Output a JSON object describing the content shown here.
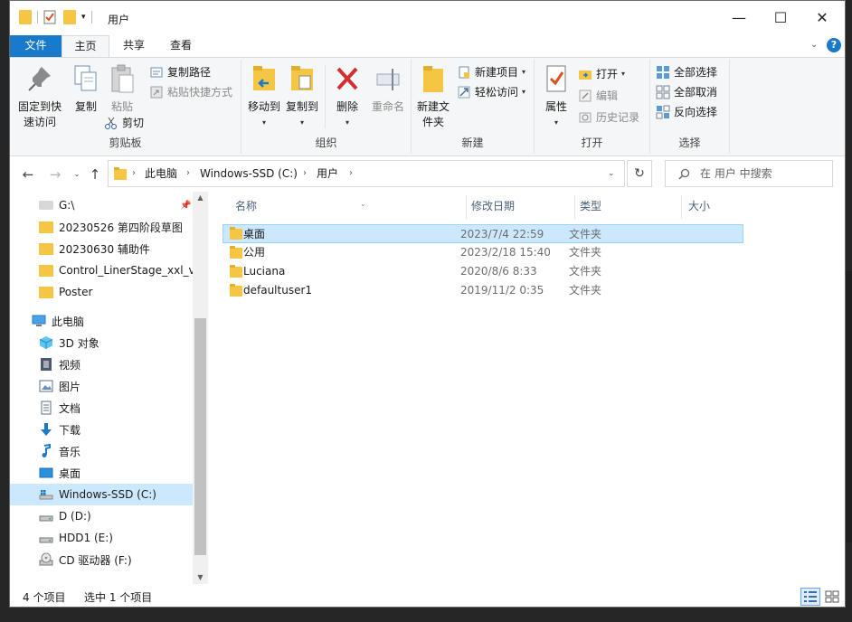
{
  "window": {
    "title": "用户"
  },
  "controls": {
    "minimize": "—",
    "maximize": "☐",
    "close": "✕"
  },
  "ribbon_tabs": [
    {
      "label": "文件"
    },
    {
      "label": "主页"
    },
    {
      "label": "共享"
    },
    {
      "label": "查看"
    }
  ],
  "help": "?",
  "ribbon": {
    "clipboard": {
      "label": "剪贴板",
      "pin_to_quick": "固定到快速访问",
      "copy": "复制",
      "paste": "粘贴",
      "copy_path": "复制路径",
      "paste_shortcut": "粘贴快捷方式",
      "cut": "剪切"
    },
    "organize": {
      "label": "组织",
      "move_to": "移动到",
      "copy_to": "复制到",
      "delete": "删除",
      "rename": "重命名"
    },
    "new": {
      "label": "新建",
      "new_folder": "新建文件夹",
      "new_item": "新建项目",
      "easy_access": "轻松访问"
    },
    "open": {
      "label": "打开",
      "properties": "属性",
      "open": "打开",
      "edit": "编辑",
      "history": "历史记录"
    },
    "select": {
      "label": "选择",
      "select_all": "全部选择",
      "select_none": "全部取消",
      "invert": "反向选择"
    }
  },
  "address": {
    "segments": [
      "此电脑",
      "Windows-SSD (C:)",
      "用户"
    ],
    "search_placeholder": "在 用户 中搜索"
  },
  "nav_pane": {
    "quick": [
      {
        "label": "G:\\",
        "pinned": true
      },
      {
        "label": "20230526 第四阶段草图"
      },
      {
        "label": "20230630 辅助件"
      },
      {
        "label": "Control_LinerStage_xxl_v4"
      },
      {
        "label": "Poster"
      }
    ],
    "this_pc": "此电脑",
    "pc_items": [
      {
        "label": "3D 对象",
        "icon": "cube-3d-icon"
      },
      {
        "label": "视频",
        "icon": "video-icon"
      },
      {
        "label": "图片",
        "icon": "pictures-icon"
      },
      {
        "label": "文档",
        "icon": "documents-icon"
      },
      {
        "label": "下载",
        "icon": "download-icon"
      },
      {
        "label": "音乐",
        "icon": "music-icon"
      },
      {
        "label": "桌面",
        "icon": "desktop-icon"
      }
    ],
    "drives": [
      {
        "label": "Windows-SSD (C:)",
        "selected": true
      },
      {
        "label": "D (D:)"
      },
      {
        "label": "HDD1 (E:)"
      },
      {
        "label": "CD 驱动器 (F:)"
      }
    ]
  },
  "columns": {
    "name": "名称",
    "modified": "修改日期",
    "type": "类型",
    "size": "大小"
  },
  "files": [
    {
      "name": "桌面",
      "modified": "2023/7/4 22:59",
      "type": "文件夹",
      "selected": true
    },
    {
      "name": "公用",
      "modified": "2023/2/18 15:40",
      "type": "文件夹"
    },
    {
      "name": "Luciana",
      "modified": "2020/8/6 8:33",
      "type": "文件夹"
    },
    {
      "name": "defaultuser1",
      "modified": "2019/11/2 0:35",
      "type": "文件夹"
    }
  ],
  "status": {
    "count": "4 个项目",
    "selected": "选中 1 个项目"
  },
  "colors": {
    "accent": "#1979ca",
    "selection": "#cce8ff",
    "folder": "#f4c644"
  }
}
